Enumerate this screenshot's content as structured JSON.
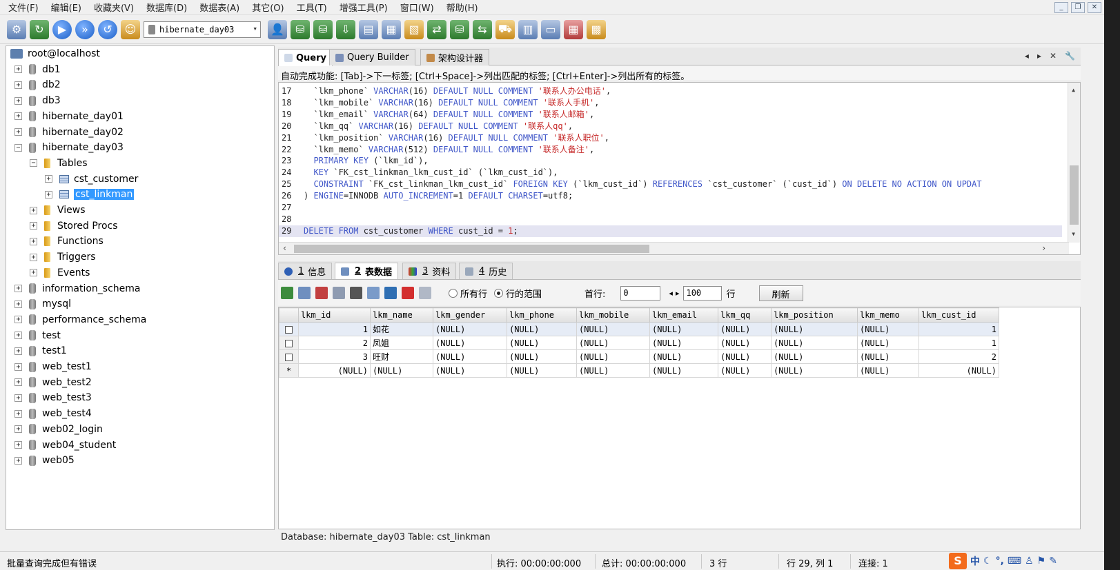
{
  "menu": [
    "文件(F)",
    "编辑(E)",
    "收藏夹(V)",
    "数据库(D)",
    "数据表(A)",
    "其它(O)",
    "工具(T)",
    "增强工具(P)",
    "窗口(W)",
    "帮助(H)"
  ],
  "toolbar": {
    "database_select": "hibernate_day03"
  },
  "tree": {
    "root": "root@localhost",
    "databases": [
      "db1",
      "db2",
      "db3",
      "hibernate_day01",
      "hibernate_day02",
      "hibernate_day03"
    ],
    "folders": [
      "Tables",
      "Views",
      "Stored Procs",
      "Functions",
      "Triggers",
      "Events"
    ],
    "tables": [
      "cst_customer",
      "cst_linkman"
    ],
    "other_databases": [
      "information_schema",
      "mysql",
      "performance_schema",
      "test",
      "test1",
      "web_test1",
      "web_test2",
      "web_test3",
      "web_test4",
      "web02_login",
      "web04_student",
      "web05"
    ]
  },
  "query_tabs": [
    "Query",
    "Query Builder",
    "架构设计器"
  ],
  "hint": "自动完成功能: [Tab]->下一标签; [Ctrl+Space]->列出匹配的标签; [Ctrl+Enter]->列出所有的标签。",
  "editor_lines": [
    {
      "n": "17",
      "parts": [
        [
          "plain",
          "  `lkm_phone` "
        ],
        [
          "kw",
          "VARCHAR"
        ],
        [
          "plain",
          "(16) "
        ],
        [
          "kw",
          "DEFAULT NULL COMMENT "
        ],
        [
          "str",
          "'联系人办公电话'"
        ],
        [
          "plain",
          ","
        ]
      ]
    },
    {
      "n": "18",
      "parts": [
        [
          "plain",
          "  `lkm_mobile` "
        ],
        [
          "kw",
          "VARCHAR"
        ],
        [
          "plain",
          "(16) "
        ],
        [
          "kw",
          "DEFAULT NULL COMMENT "
        ],
        [
          "str",
          "'联系人手机'"
        ],
        [
          "plain",
          ","
        ]
      ]
    },
    {
      "n": "19",
      "parts": [
        [
          "plain",
          "  `lkm_email` "
        ],
        [
          "kw",
          "VARCHAR"
        ],
        [
          "plain",
          "(64) "
        ],
        [
          "kw",
          "DEFAULT NULL COMMENT "
        ],
        [
          "str",
          "'联系人邮箱'"
        ],
        [
          "plain",
          ","
        ]
      ]
    },
    {
      "n": "20",
      "parts": [
        [
          "plain",
          "  `lkm_qq` "
        ],
        [
          "kw",
          "VARCHAR"
        ],
        [
          "plain",
          "(16) "
        ],
        [
          "kw",
          "DEFAULT NULL COMMENT "
        ],
        [
          "str",
          "'联系人qq'"
        ],
        [
          "plain",
          ","
        ]
      ]
    },
    {
      "n": "21",
      "parts": [
        [
          "plain",
          "  `lkm_position` "
        ],
        [
          "kw",
          "VARCHAR"
        ],
        [
          "plain",
          "(16) "
        ],
        [
          "kw",
          "DEFAULT NULL COMMENT "
        ],
        [
          "str",
          "'联系人职位'"
        ],
        [
          "plain",
          ","
        ]
      ]
    },
    {
      "n": "22",
      "parts": [
        [
          "plain",
          "  `lkm_memo` "
        ],
        [
          "kw",
          "VARCHAR"
        ],
        [
          "plain",
          "(512) "
        ],
        [
          "kw",
          "DEFAULT NULL COMMENT "
        ],
        [
          "str",
          "'联系人备注'"
        ],
        [
          "plain",
          ","
        ]
      ]
    },
    {
      "n": "23",
      "parts": [
        [
          "kw",
          "  PRIMARY KEY "
        ],
        [
          "plain",
          "(`lkm_id`),"
        ]
      ]
    },
    {
      "n": "24",
      "parts": [
        [
          "kw",
          "  KEY "
        ],
        [
          "plain",
          "`FK_cst_linkman_lkm_cust_id` (`lkm_cust_id`),"
        ]
      ]
    },
    {
      "n": "25",
      "parts": [
        [
          "kw",
          "  CONSTRAINT "
        ],
        [
          "plain",
          "`FK_cst_linkman_lkm_cust_id` "
        ],
        [
          "kw",
          "FOREIGN KEY "
        ],
        [
          "plain",
          "(`lkm_cust_id`) "
        ],
        [
          "kw",
          "REFERENCES "
        ],
        [
          "plain",
          "`cst_customer` (`cust_id`) "
        ],
        [
          "kw",
          "ON DELETE NO ACTION ON UPDAT"
        ]
      ]
    },
    {
      "n": "26",
      "parts": [
        [
          "plain",
          ") "
        ],
        [
          "kw",
          "ENGINE"
        ],
        [
          "plain",
          "=INNODB "
        ],
        [
          "kw",
          "AUTO_INCREMENT"
        ],
        [
          "plain",
          "=1 "
        ],
        [
          "kw",
          "DEFAULT CHARSET"
        ],
        [
          "plain",
          "=utf8;"
        ]
      ]
    },
    {
      "n": "27",
      "parts": []
    },
    {
      "n": "28",
      "parts": []
    },
    {
      "n": "29",
      "parts": [
        [
          "kw",
          "DELETE FROM "
        ],
        [
          "plain",
          "cst_customer "
        ],
        [
          "kw",
          "WHERE "
        ],
        [
          "plain",
          "cust_id = "
        ],
        [
          "str",
          "1"
        ],
        [
          "plain",
          ";"
        ]
      ],
      "highlight": true
    }
  ],
  "result_tabs": [
    {
      "num": "1",
      "label": "信息"
    },
    {
      "num": "2",
      "label": "表数据"
    },
    {
      "num": "3",
      "label": "资料"
    },
    {
      "num": "4",
      "label": "历史"
    }
  ],
  "result_toolbar": {
    "radio_all": "所有行",
    "radio_range": "行的范围",
    "first_row_label": "首行:",
    "first_row_value": "0",
    "row_count_value": "100",
    "row_unit": "行",
    "refresh": "刷新"
  },
  "grid": {
    "columns": [
      "lkm_id",
      "lkm_name",
      "lkm_gender",
      "lkm_phone",
      "lkm_mobile",
      "lkm_email",
      "lkm_qq",
      "lkm_position",
      "lkm_memo",
      "lkm_cust_id"
    ],
    "rows": [
      [
        "1",
        "如花",
        "(NULL)",
        "(NULL)",
        "(NULL)",
        "(NULL)",
        "(NULL)",
        "(NULL)",
        "(NULL)",
        "1"
      ],
      [
        "2",
        "凤姐",
        "(NULL)",
        "(NULL)",
        "(NULL)",
        "(NULL)",
        "(NULL)",
        "(NULL)",
        "(NULL)",
        "1"
      ],
      [
        "3",
        "旺财",
        "(NULL)",
        "(NULL)",
        "(NULL)",
        "(NULL)",
        "(NULL)",
        "(NULL)",
        "(NULL)",
        "2"
      ],
      [
        "(NULL)",
        "(NULL)",
        "(NULL)",
        "(NULL)",
        "(NULL)",
        "(NULL)",
        "(NULL)",
        "(NULL)",
        "(NULL)",
        "(NULL)"
      ]
    ],
    "new_row_marker": "*"
  },
  "dbinfo": "Database: hibernate_day03  Table: cst_linkman",
  "status": {
    "message": "批量查询完成但有错误",
    "exec": "执行: 00:00:00:000",
    "total": "总计: 00:00:00:000",
    "rows": "3 行",
    "position": "行 29, 列 1",
    "connections": "连接: 1",
    "ime_logo": "S",
    "ime_mode": "中"
  },
  "colors": {
    "keyword": "#3f56c8",
    "string": "#c62828",
    "selection": "#3399ff",
    "ime": "#f36b1c"
  }
}
